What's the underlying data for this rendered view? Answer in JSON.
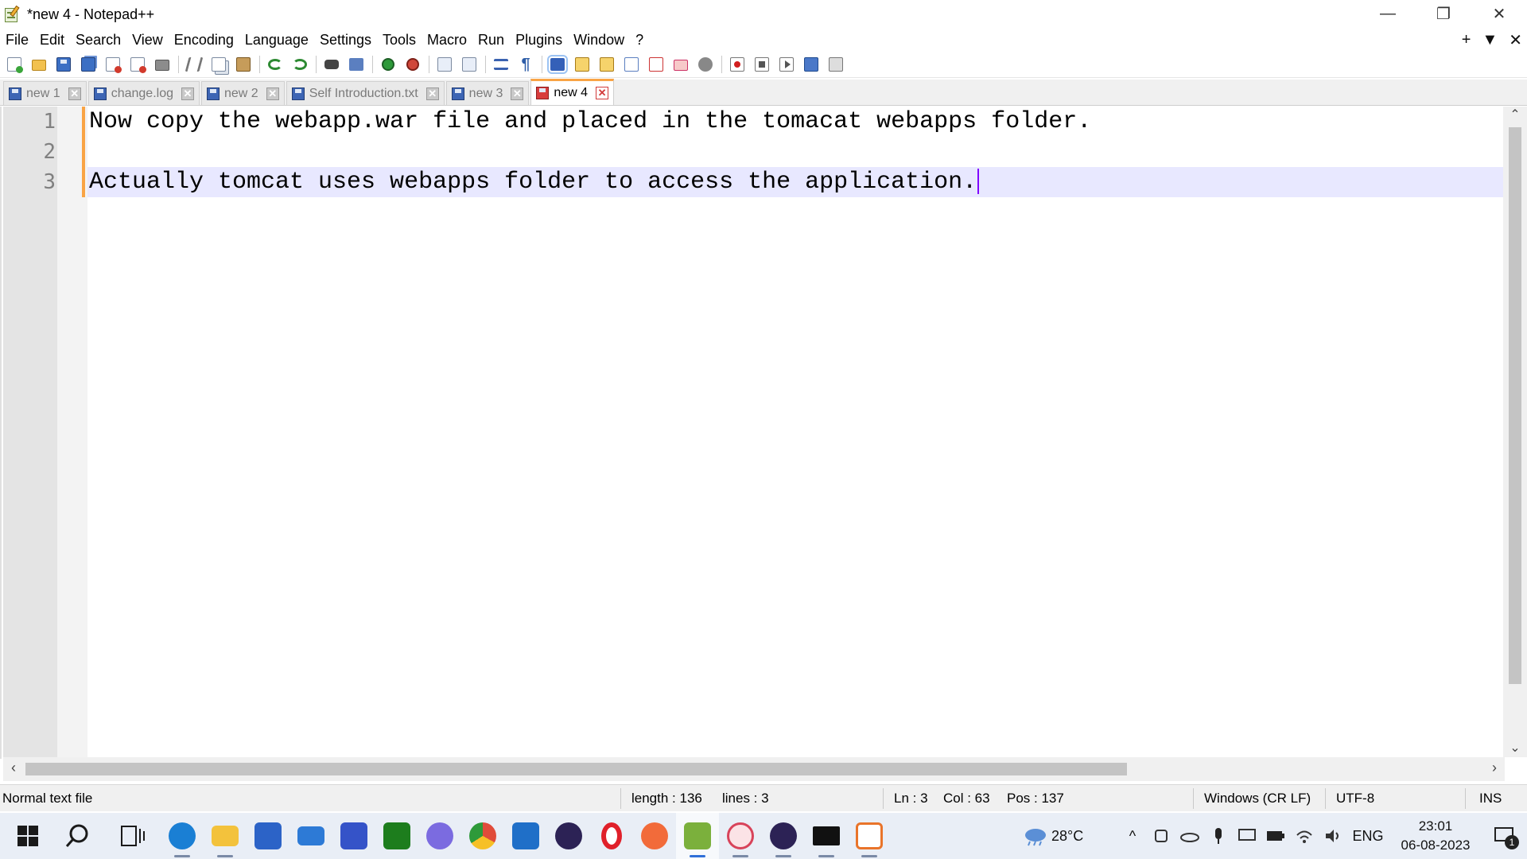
{
  "window": {
    "title": "*new 4 - Notepad++",
    "controls": {
      "minimize": "—",
      "restore": "❐",
      "close": "✕"
    }
  },
  "menu": {
    "items": [
      "File",
      "Edit",
      "Search",
      "View",
      "Encoding",
      "Language",
      "Settings",
      "Tools",
      "Macro",
      "Run",
      "Plugins",
      "Window",
      "?"
    ],
    "right": {
      "add": "+",
      "dropdown": "▼",
      "close": "✕"
    }
  },
  "tabs": [
    {
      "label": "new 1",
      "active": false
    },
    {
      "label": "change.log",
      "active": false
    },
    {
      "label": "new 2",
      "active": false
    },
    {
      "label": "Self Introduction.txt",
      "active": false
    },
    {
      "label": "new 3",
      "active": false
    },
    {
      "label": "new 4",
      "active": true
    }
  ],
  "tab_close_glyph": "✕",
  "editor": {
    "lines": [
      {
        "number": "1",
        "text": "Now copy the webapp.war file and placed in the tomacat webapps folder."
      },
      {
        "number": "2",
        "text": ""
      },
      {
        "number": "3",
        "text": "Actually tomcat uses webapps folder to access the application."
      }
    ],
    "current_line": 3,
    "caret_color": "#8000ff",
    "current_line_color": "#e8e8ff"
  },
  "scroll": {
    "up": "⌃",
    "down": "⌄",
    "left": "‹",
    "right": "›"
  },
  "status": {
    "file_type": "Normal text file",
    "length": "length : 136",
    "lines": "lines : 3",
    "ln": "Ln : 3",
    "col": "Col : 63",
    "pos": "Pos : 137",
    "eol": "Windows (CR LF)",
    "encoding": "UTF-8",
    "mode": "INS"
  },
  "taskbar": {
    "apps": [
      {
        "name": "windows-start",
        "color": "#1a1a1a"
      },
      {
        "name": "search",
        "color": "#1a1a1a"
      },
      {
        "name": "task-view",
        "color": "#1a1a1a"
      },
      {
        "name": "edge",
        "color": "#1a7fd4"
      },
      {
        "name": "file-explorer",
        "color": "#f3c23c"
      },
      {
        "name": "microsoft-store",
        "color": "#2c63c7"
      },
      {
        "name": "mail",
        "color": "#2d7ad6"
      },
      {
        "name": "teamviewer",
        "color": "#3553c8"
      },
      {
        "name": "xbox",
        "color": "#1d7d1d"
      },
      {
        "name": "copilot",
        "color": "#7b6be0"
      },
      {
        "name": "chrome",
        "color": "#e04b3a"
      },
      {
        "name": "remote-desktop",
        "color": "#1f6fc8"
      },
      {
        "name": "eclipse",
        "color": "#2c2255"
      },
      {
        "name": "opera",
        "color": "#e0202a"
      },
      {
        "name": "postman",
        "color": "#f26b3a"
      },
      {
        "name": "notepad-plus-plus",
        "color": "#7bb03c"
      },
      {
        "name": "snipping-tool",
        "color": "#d8435a"
      },
      {
        "name": "eclipse-2",
        "color": "#2c2255"
      },
      {
        "name": "terminal",
        "color": "#111111"
      },
      {
        "name": "java",
        "color": "#e9742a"
      }
    ],
    "tray": {
      "weather": "28°C",
      "chevron": "^",
      "language": "ENG",
      "time": "23:01",
      "date": "06-08-2023",
      "notifications": "1"
    }
  }
}
